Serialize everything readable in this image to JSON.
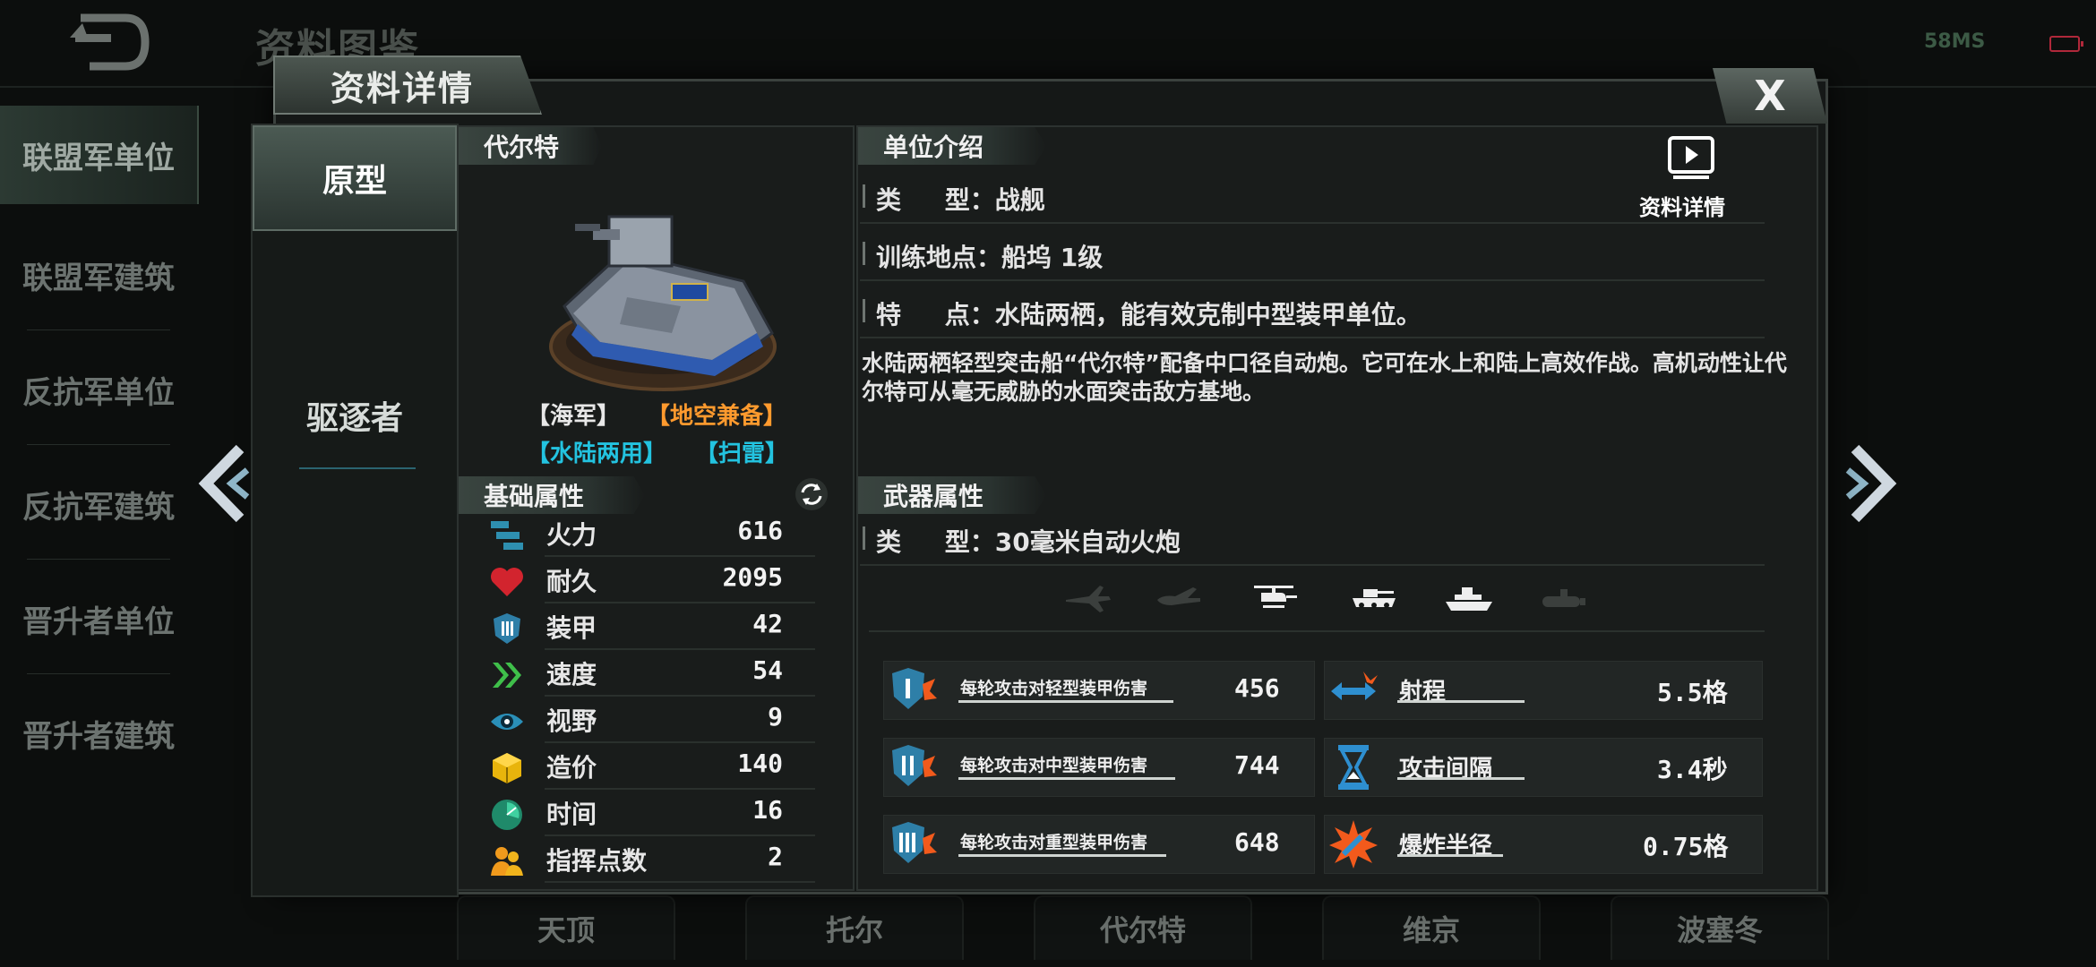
{
  "background": {
    "title": "资料图鉴",
    "ping": "58MS",
    "left_nav": [
      "联盟军单位",
      "联盟军建筑",
      "反抗军单位",
      "反抗军建筑",
      "晋升者单位",
      "晋升者建筑"
    ],
    "bottom_tabs": [
      "天顶",
      "托尔",
      "代尔特",
      "维京",
      "波塞冬"
    ]
  },
  "modal": {
    "title": "资料详情",
    "close_label": "X",
    "tabs": [
      "原型",
      "驱逐者"
    ]
  },
  "unit": {
    "name": "代尔特",
    "tags": [
      {
        "text": "【海军】",
        "color": "#ffffff"
      },
      {
        "text": "【地空兼备】",
        "color": "#ff9a2e"
      },
      {
        "text": "【水陆两用】",
        "color": "#23c3e0"
      },
      {
        "text": "【扫雷】",
        "color": "#23c3e0"
      }
    ]
  },
  "base_stats": {
    "header": "基础属性",
    "rows": [
      {
        "label": "火力",
        "value": "616",
        "icon": "firepower-icon"
      },
      {
        "label": "耐久",
        "value": "2095",
        "icon": "heart-icon"
      },
      {
        "label": "装甲",
        "value": "42",
        "icon": "armor-shield-icon"
      },
      {
        "label": "速度",
        "value": "54",
        "icon": "speed-chevron-icon"
      },
      {
        "label": "视野",
        "value": "9",
        "icon": "eye-icon"
      },
      {
        "label": "造价",
        "value": "140",
        "icon": "cost-cube-icon"
      },
      {
        "label": "时间",
        "value": "16",
        "icon": "clock-icon"
      },
      {
        "label": "指挥点数",
        "value": "2",
        "icon": "command-people-icon"
      }
    ]
  },
  "intro": {
    "header": "单位介绍",
    "detail_label": "资料详情",
    "type_line": "类     型：战舰",
    "train_line": "训练地点：船坞 1级",
    "feature_line": "特     点：水陆两栖，能有效克制中型装甲单位。",
    "description": "水陆两栖轻型突击船“代尔特”配备中口径自动炮。它可在水上和陆上高效作战。高机动性让代尔特可从毫无威胁的水面突击敌方基地。"
  },
  "weapon": {
    "header": "武器属性",
    "type_line": "类     型：30毫米自动火炮",
    "targets": [
      {
        "name": "fighter-jet-icon",
        "active": false
      },
      {
        "name": "bomber-icon",
        "active": false
      },
      {
        "name": "helicopter-icon",
        "active": true
      },
      {
        "name": "tank-icon",
        "active": true
      },
      {
        "name": "ship-icon",
        "active": true
      },
      {
        "name": "submarine-icon",
        "active": false
      }
    ],
    "damage": [
      {
        "label": "每轮攻击对轻型装甲伤害",
        "value": "456"
      },
      {
        "label": "每轮攻击对中型装甲伤害",
        "value": "744"
      },
      {
        "label": "每轮攻击对重型装甲伤害",
        "value": "648"
      }
    ],
    "props": [
      {
        "label": "射程",
        "value": "5.5格"
      },
      {
        "label": "攻击间隔",
        "value": "3.4秒"
      },
      {
        "label": "爆炸半径",
        "value": "0.75格"
      }
    ]
  }
}
